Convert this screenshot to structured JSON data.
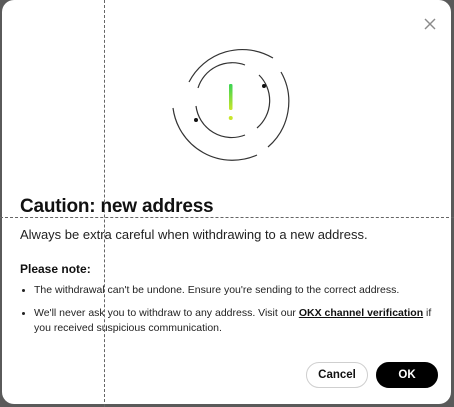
{
  "dialog": {
    "title": "Caution: new address",
    "subtitle": "Always be extra careful when withdrawing to a new address.",
    "note_heading": "Please note:",
    "bullets": {
      "first": "The withdrawal can't be undone. Ensure you're sending to the correct address.",
      "second_before": "We'll never ask you to withdraw to any address. Visit our ",
      "second_link": "OKX channel verification",
      "second_after": " if you received suspicious communication."
    },
    "cancel_label": "Cancel",
    "ok_label": "OK"
  },
  "icons": {
    "close": "close-icon",
    "illustration": "exclamation-circles-icon"
  },
  "colors": {
    "primary_button": "#000000",
    "exclamation_top": "#39d353",
    "exclamation_bottom": "#c8e62b",
    "overlay": "#5a5a5a"
  }
}
